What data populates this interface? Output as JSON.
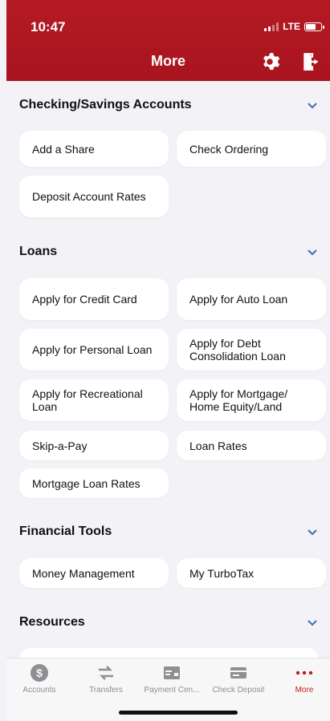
{
  "status": {
    "time": "10:47",
    "network": "LTE"
  },
  "header": {
    "title": "More"
  },
  "sections": [
    {
      "title": "Checking/Savings Accounts",
      "items": [
        "Add a Share",
        "Check Ordering",
        "Deposit Account Rates"
      ]
    },
    {
      "title": "Loans",
      "items": [
        "Apply for Credit Card",
        "Apply for Auto Loan",
        "Apply for Personal Loan",
        "Apply for Debt Consolidation Loan",
        "Apply for Recreational Loan",
        "Apply for Mortgage/ Home Equity/Land",
        "Skip-a-Pay",
        "Loan Rates",
        "Mortgage Loan Rates"
      ]
    },
    {
      "title": "Financial Tools",
      "items": [
        "Money Management",
        "My TurboTax"
      ]
    },
    {
      "title": "Resources",
      "items": []
    }
  ],
  "tabs": [
    {
      "label": "Accounts",
      "icon": "dollar-circle-icon"
    },
    {
      "label": "Transfers",
      "icon": "transfer-arrows-icon"
    },
    {
      "label": "Payment Cen...",
      "icon": "payment-center-icon"
    },
    {
      "label": "Check Deposit",
      "icon": "check-deposit-icon"
    },
    {
      "label": "More",
      "icon": "more-dots-icon",
      "active": true
    }
  ],
  "colors": {
    "brand": "#b51a24",
    "accent_chevron": "#3a6fb5",
    "active_tab": "#c21b23"
  }
}
